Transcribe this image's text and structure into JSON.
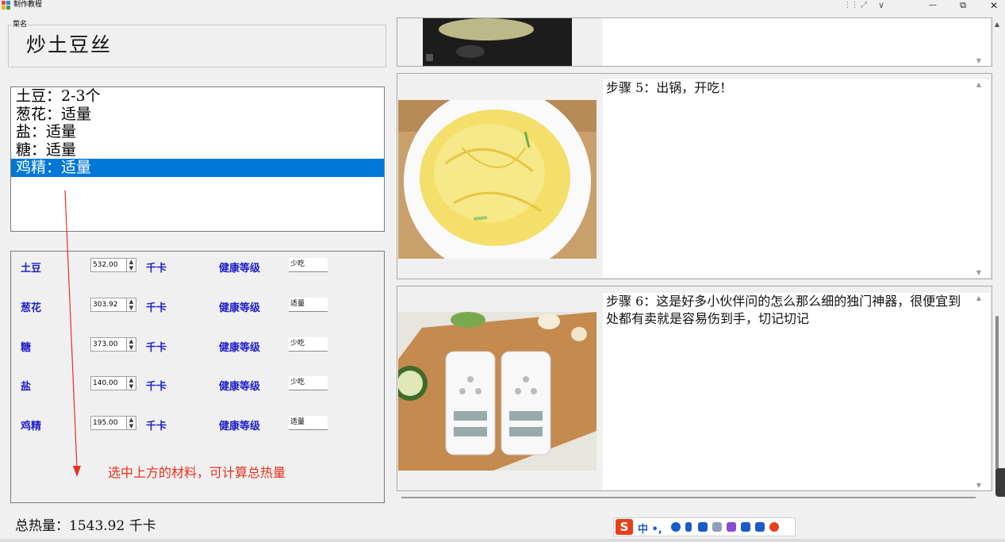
{
  "window": {
    "title": "制作教程",
    "controls": {
      "layout": "⋮⋮",
      "expand": "⤢",
      "chevron": "∨",
      "minimize": "—",
      "restore": "⧉",
      "close": "✕"
    }
  },
  "dish": {
    "label": "菜名",
    "name": "炒土豆丝"
  },
  "ingredients": {
    "items": [
      "土豆：2-3个",
      "葱花：适量",
      "盐：适量",
      "糖：适量",
      "鸡精：适量"
    ],
    "selected_index": 4
  },
  "calculator": {
    "kcal_unit": "千卡",
    "health_label": "健康等级",
    "spin_up": "▲",
    "spin_down": "▼",
    "rows": [
      {
        "name": "土豆",
        "value": "532.00",
        "health": "少吃"
      },
      {
        "name": "葱花",
        "value": "303.92",
        "health": "适量"
      },
      {
        "name": "糖",
        "value": "373.00",
        "health": "少吃"
      },
      {
        "name": "盐",
        "value": "140.00",
        "health": "少吃"
      },
      {
        "name": "鸡精",
        "value": "195.00",
        "health": "适量"
      }
    ],
    "hint": "选中上方的材料，可计算总热量"
  },
  "total": {
    "text": "总热量：1543.92 千卡"
  },
  "steps": [
    {
      "text": ""
    },
    {
      "text": "步骤 5：出锅，开吃！"
    },
    {
      "text": "步骤 6：这是好多小伙伴问的怎么那么细的独门神器，很便宜到处都有卖就是容易伤到手，切记切记"
    }
  ],
  "scroll": {
    "up": "▲",
    "down": "▼"
  },
  "ime": {
    "logo": "S",
    "mode": "中 •,"
  },
  "colors": {
    "selection": "#0078d7",
    "label_blue": "#1e1ec8",
    "hint_red": "#e8301c"
  }
}
